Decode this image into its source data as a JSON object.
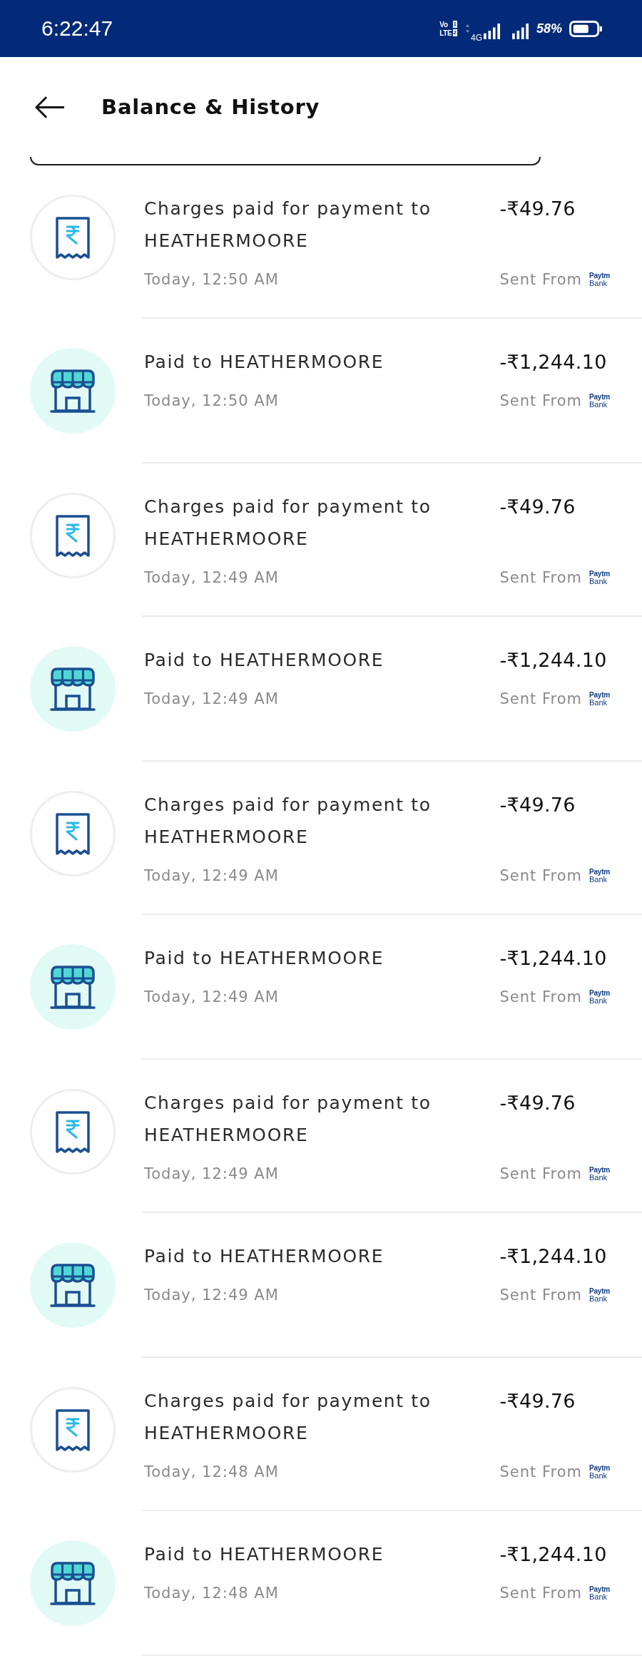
{
  "status_bar": {
    "time": "6:22:47",
    "volte": {
      "top": "Vo",
      "bottom": "LTE",
      "sims": [
        "1",
        "2"
      ]
    },
    "network": "4G",
    "battery_percent": "58%"
  },
  "header": {
    "title": "Balance & History"
  },
  "transactions": [
    {
      "kind": "charges",
      "title": "Charges paid for payment to HEATHERMOORE",
      "time": "Today, 12:50 AM",
      "amount": "-₹49.76",
      "source_label": "Sent From",
      "source_logo": {
        "top": "Paytm",
        "bottom": "Bank"
      }
    },
    {
      "kind": "payment",
      "title": "Paid to HEATHERMOORE",
      "time": "Today, 12:50 AM",
      "amount": "-₹1,244.10",
      "source_label": "Sent From",
      "source_logo": {
        "top": "Paytm",
        "bottom": "Bank"
      }
    },
    {
      "kind": "charges",
      "title": "Charges paid for payment to HEATHERMOORE",
      "time": "Today, 12:49 AM",
      "amount": "-₹49.76",
      "source_label": "Sent From",
      "source_logo": {
        "top": "Paytm",
        "bottom": "Bank"
      }
    },
    {
      "kind": "payment",
      "title": "Paid to HEATHERMOORE",
      "time": "Today, 12:49 AM",
      "amount": "-₹1,244.10",
      "source_label": "Sent From",
      "source_logo": {
        "top": "Paytm",
        "bottom": "Bank"
      }
    },
    {
      "kind": "charges",
      "title": "Charges paid for payment to HEATHERMOORE",
      "time": "Today, 12:49 AM",
      "amount": "-₹49.76",
      "source_label": "Sent From",
      "source_logo": {
        "top": "Paytm",
        "bottom": "Bank"
      }
    },
    {
      "kind": "payment",
      "title": "Paid to HEATHERMOORE",
      "time": "Today, 12:49 AM",
      "amount": "-₹1,244.10",
      "source_label": "Sent From",
      "source_logo": {
        "top": "Paytm",
        "bottom": "Bank"
      }
    },
    {
      "kind": "charges",
      "title": "Charges paid for payment to HEATHERMOORE",
      "time": "Today, 12:49 AM",
      "amount": "-₹49.76",
      "source_label": "Sent From",
      "source_logo": {
        "top": "Paytm",
        "bottom": "Bank"
      }
    },
    {
      "kind": "payment",
      "title": "Paid to HEATHERMOORE",
      "time": "Today, 12:49 AM",
      "amount": "-₹1,244.10",
      "source_label": "Sent From",
      "source_logo": {
        "top": "Paytm",
        "bottom": "Bank"
      }
    },
    {
      "kind": "charges",
      "title": "Charges paid for payment to HEATHERMOORE",
      "time": "Today, 12:48 AM",
      "amount": "-₹49.76",
      "source_label": "Sent From",
      "source_logo": {
        "top": "Paytm",
        "bottom": "Bank"
      }
    },
    {
      "kind": "payment",
      "title": "Paid to HEATHERMOORE",
      "time": "Today, 12:48 AM",
      "amount": "-₹1,244.10",
      "source_label": "Sent From",
      "source_logo": {
        "top": "Paytm",
        "bottom": "Bank"
      }
    }
  ]
}
